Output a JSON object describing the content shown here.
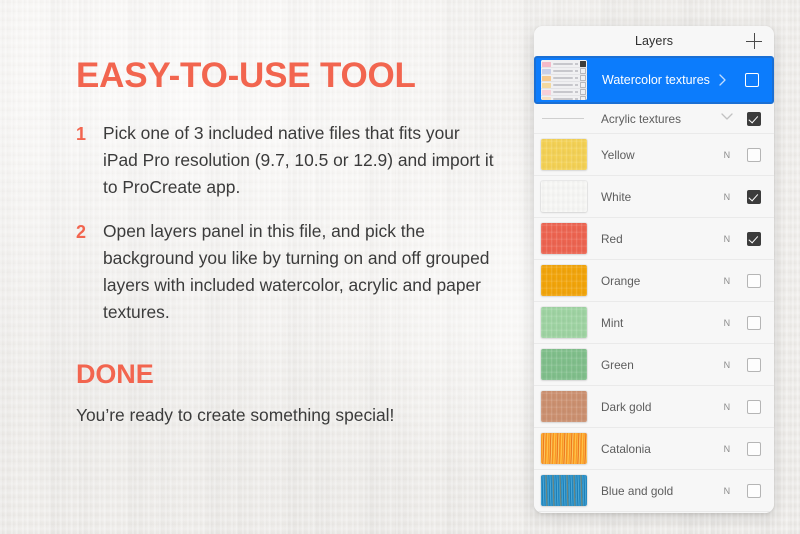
{
  "content": {
    "headline": "EASY-TO-USE TOOL",
    "steps": [
      {
        "number": "1",
        "text": "Pick one of 3 included native files that fits your iPad Pro resolution (9.7, 10.5 or 12.9) and import it to ProCreate app."
      },
      {
        "number": "2",
        "text": "Open layers panel in this file, and pick the background you like by turning on and off grouped layers with included watercolor, acrylic and paper textures."
      }
    ],
    "done_heading": "DONE",
    "done_text": "You’re ready to create something special!",
    "accent_color": "#f2654f",
    "text_color": "#3b3b3b"
  },
  "layers_panel": {
    "title": "Layers",
    "add_button_icon": "plus-icon",
    "selected_row_color": "#0c7cfc",
    "rows": [
      {
        "name": "Watercolor textures",
        "type": "group",
        "selected": true,
        "mode": "",
        "chevron": "right",
        "visible": false,
        "thumb_kind": "mini-list",
        "mini_swatches": [
          "#f4b9c8",
          "#c9cfe8",
          "#f6c98f",
          "#f3d9a0",
          "#f7cfd8",
          "#f6e0c4"
        ]
      },
      {
        "name": "Acrylic textures",
        "type": "group",
        "selected": false,
        "mode": "",
        "chevron": "down",
        "visible": true,
        "thumb_kind": "empty"
      },
      {
        "name": "Yellow",
        "type": "layer",
        "mode": "N",
        "visible": false,
        "thumb_kind": "color",
        "color": "#f7d455"
      },
      {
        "name": "White",
        "type": "layer",
        "mode": "N",
        "visible": true,
        "thumb_kind": "color",
        "color": "#fafaf8"
      },
      {
        "name": "Red",
        "type": "layer",
        "mode": "N",
        "visible": true,
        "thumb_kind": "color",
        "color": "#f06450"
      },
      {
        "name": "Orange",
        "type": "layer",
        "mode": "N",
        "visible": false,
        "thumb_kind": "color",
        "color": "#f5a608"
      },
      {
        "name": "Mint",
        "type": "layer",
        "mode": "N",
        "visible": false,
        "thumb_kind": "color",
        "color": "#a0d6a4"
      },
      {
        "name": "Green",
        "type": "layer",
        "mode": "N",
        "visible": false,
        "thumb_kind": "color",
        "color": "#81c18c"
      },
      {
        "name": "Dark gold",
        "type": "layer",
        "mode": "N",
        "visible": false,
        "thumb_kind": "color",
        "color": "#ce9170"
      },
      {
        "name": "Catalonia",
        "type": "layer",
        "mode": "N",
        "visible": false,
        "thumb_kind": "catalonia",
        "color": "#f7a432"
      },
      {
        "name": "Blue and gold",
        "type": "layer",
        "mode": "N",
        "visible": false,
        "thumb_kind": "blue",
        "color": "#2b8fc4"
      }
    ]
  }
}
